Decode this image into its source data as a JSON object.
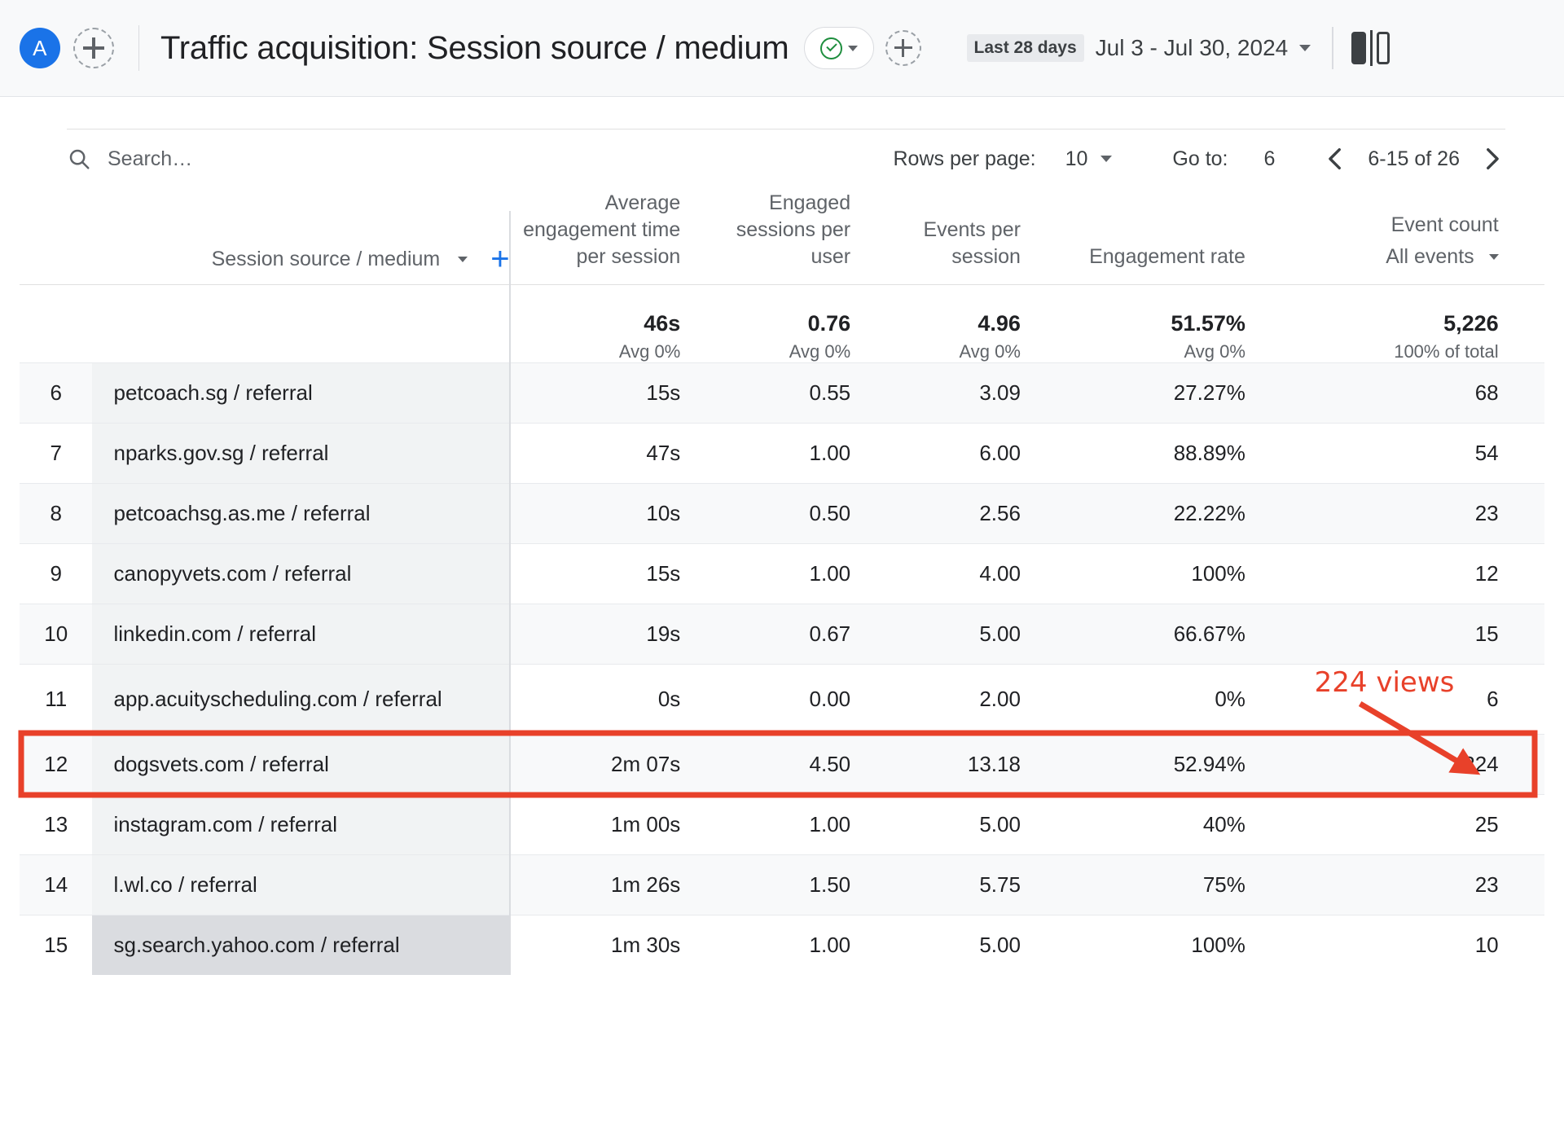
{
  "header": {
    "avatar_letter": "A",
    "avatar_color": "#1a73e8",
    "add_icon": "plus-icon",
    "title": "Traffic acquisition: Session source / medium",
    "check_icon": "check-circle-icon",
    "check_caret_icon": "chevron-down-icon",
    "add_comparison_icon": "plus-icon",
    "date_chip": "Last 28 days",
    "date_range": "Jul 3 - Jul 30, 2024",
    "date_caret_icon": "chevron-down-icon",
    "panel_icon": "side-panel-icon"
  },
  "controls": {
    "search_icon": "search-icon",
    "search_placeholder": "Search…",
    "search_value": "",
    "rows_per_page_label": "Rows per page:",
    "rows_per_page_value": "10",
    "rows_per_page_caret": "chevron-down-icon",
    "goto_label": "Go to:",
    "goto_value": "6",
    "prev_icon": "chevron-left-icon",
    "next_icon": "chevron-right-icon",
    "page_range": "6-15 of 26"
  },
  "table": {
    "dimension_header": "Session source / medium",
    "dimension_caret": "chevron-down-icon",
    "add_dimension_icon": "plus-icon",
    "columns": [
      "Average engagement time per session",
      "Engaged sessions per user",
      "Events per session",
      "Engagement rate",
      "Event count"
    ],
    "event_count_selector": "All events",
    "event_count_caret": "chevron-down-icon",
    "totals": [
      {
        "value": "46s",
        "sub": "Avg 0%"
      },
      {
        "value": "0.76",
        "sub": "Avg 0%"
      },
      {
        "value": "4.96",
        "sub": "Avg 0%"
      },
      {
        "value": "51.57%",
        "sub": "Avg 0%"
      },
      {
        "value": "5,226",
        "sub": "100% of total"
      }
    ],
    "rows": [
      {
        "index": "6",
        "dimension": "petcoach.sg / referral",
        "avg_engagement": "15s",
        "engaged_sessions_per_user": "0.55",
        "events_per_session": "3.09",
        "engagement_rate": "27.27%",
        "event_count": "68"
      },
      {
        "index": "7",
        "dimension": "nparks.gov.sg / referral",
        "avg_engagement": "47s",
        "engaged_sessions_per_user": "1.00",
        "events_per_session": "6.00",
        "engagement_rate": "88.89%",
        "event_count": "54"
      },
      {
        "index": "8",
        "dimension": "petcoachsg.as.me / referral",
        "avg_engagement": "10s",
        "engaged_sessions_per_user": "0.50",
        "events_per_session": "2.56",
        "engagement_rate": "22.22%",
        "event_count": "23"
      },
      {
        "index": "9",
        "dimension": "canopyvets.com / referral",
        "avg_engagement": "15s",
        "engaged_sessions_per_user": "1.00",
        "events_per_session": "4.00",
        "engagement_rate": "100%",
        "event_count": "12"
      },
      {
        "index": "10",
        "dimension": "linkedin.com / referral",
        "avg_engagement": "19s",
        "engaged_sessions_per_user": "0.67",
        "events_per_session": "5.00",
        "engagement_rate": "66.67%",
        "event_count": "15"
      },
      {
        "index": "11",
        "dimension": "app.acuityscheduling.com / referral",
        "avg_engagement": "0s",
        "engaged_sessions_per_user": "0.00",
        "events_per_session": "2.00",
        "engagement_rate": "0%",
        "event_count": "6"
      },
      {
        "index": "12",
        "dimension": "dogsvets.com / referral",
        "avg_engagement": "2m 07s",
        "engaged_sessions_per_user": "4.50",
        "events_per_session": "13.18",
        "engagement_rate": "52.94%",
        "event_count": "224"
      },
      {
        "index": "13",
        "dimension": "instagram.com / referral",
        "avg_engagement": "1m 00s",
        "engaged_sessions_per_user": "1.00",
        "events_per_session": "5.00",
        "engagement_rate": "40%",
        "event_count": "25"
      },
      {
        "index": "14",
        "dimension": "l.wl.co / referral",
        "avg_engagement": "1m 26s",
        "engaged_sessions_per_user": "1.50",
        "events_per_session": "5.75",
        "engagement_rate": "75%",
        "event_count": "23"
      },
      {
        "index": "15",
        "dimension": "sg.search.yahoo.com / referral",
        "avg_engagement": "1m 30s",
        "engaged_sessions_per_user": "1.00",
        "events_per_session": "5.00",
        "engagement_rate": "100%",
        "event_count": "10"
      }
    ],
    "highlighted_row_index": "12",
    "hovered_row_index": "15"
  },
  "annotation": {
    "label": "224 views",
    "color": "#e8412a",
    "highlight_color": "#e8412a"
  }
}
